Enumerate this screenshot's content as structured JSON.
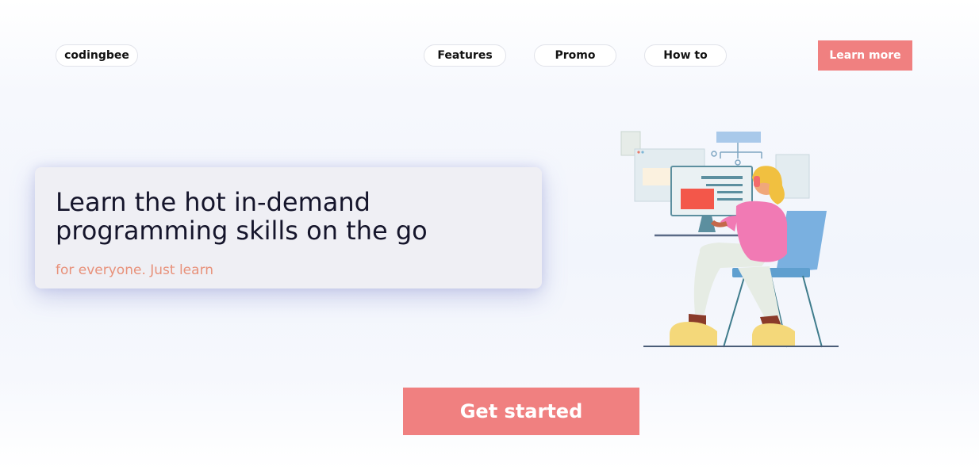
{
  "nav": {
    "brand": "codingbee",
    "items": [
      {
        "label": "Features"
      },
      {
        "label": "Promo"
      },
      {
        "label": "How to"
      }
    ],
    "cta_label": "Learn more"
  },
  "hero": {
    "title": "Learn the hot in-demand programming skills on the go",
    "subtitle": "for everyone. Just learn"
  },
  "cta": {
    "label": "Get started"
  },
  "colors": {
    "accent": "#f08080",
    "subtitle": "#e8917a",
    "title": "#15152b"
  },
  "illustration": {
    "icon": "person-at-computer-illustration"
  }
}
